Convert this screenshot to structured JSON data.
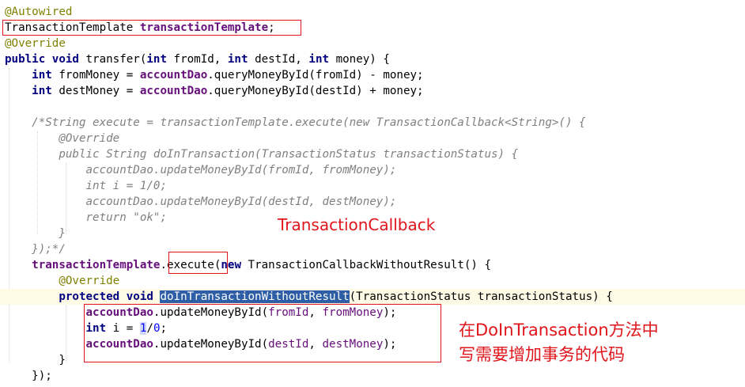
{
  "code": {
    "l1": "@Autowired",
    "l2_type": "TransactionTemplate ",
    "l2_field": "transactionTemplate",
    "l2_semi": ";",
    "l3": "@Override",
    "l4_kw": "public void ",
    "l4_a": "transfer(",
    "l4_int1": "int ",
    "l4_b": "fromId, ",
    "l4_int2": "int ",
    "l4_c": "destId, ",
    "l4_int3": "int ",
    "l4_d": "money) {",
    "l5_int": "int ",
    "l5_a": "fromMoney = ",
    "l5_dao": "accountDao",
    "l5_b": ".queryMoneyById(fromId) - money;",
    "l6_int": "int ",
    "l6_a": "destMoney = ",
    "l6_dao": "accountDao",
    "l6_b": ".queryMoneyById(destId) + money;",
    "l8": "/*String execute = transactionTemplate.execute(new TransactionCallback<String>() {",
    "l9": "@Override",
    "l10": "public String doInTransaction(TransactionStatus transactionStatus) {",
    "l11": "accountDao.updateMoneyById(fromId, fromMoney);",
    "l12": "int i = 1/0;",
    "l13": "accountDao.updateMoneyById(destId, destMoney);",
    "l14": "return \"ok\";",
    "l15": "}",
    "l16": "});*/",
    "l17_field": "transactionTemplate",
    "l17_a": ".execute",
    "l17_b": "(",
    "l17_new": "new ",
    "l17_c": "TransactionCallbackWithoutResult() {",
    "l18": "@Override",
    "l19_kw": "protected void ",
    "l19_method": "doInTransactionWithoutResult",
    "l19_rest": "(TransactionStatus transactionStatus) {",
    "l20_dao": "accountDao",
    "l20_a": ".updateMoneyById(",
    "l20_p1": "fromId",
    "l20_b": ", ",
    "l20_p2": "fromMoney",
    "l20_c": ");",
    "l21_int": "int ",
    "l21_a": "i = ",
    "l21_n1": "1",
    "l21_b": "/",
    "l21_n2": "0",
    "l21_c": ";",
    "l22_dao": "accountDao",
    "l22_a": ".updateMoneyById(",
    "l22_p1": "destId",
    "l22_b": ", ",
    "l22_p2": "destMoney",
    "l22_c": ");",
    "l23": "}",
    "l24": "});"
  },
  "annotations": {
    "callback_label": "TransactionCallback",
    "note_line1": "在DoInTransaction方法中",
    "note_line2": "写需要增加事务的代码"
  },
  "colors": {
    "annotation": "#808000",
    "keyword": "#000080",
    "field": "#660e7a",
    "comment": "#808080",
    "number": "#0000ff",
    "highlight_box": "#e0151b",
    "selection": "#2e5fa6"
  }
}
